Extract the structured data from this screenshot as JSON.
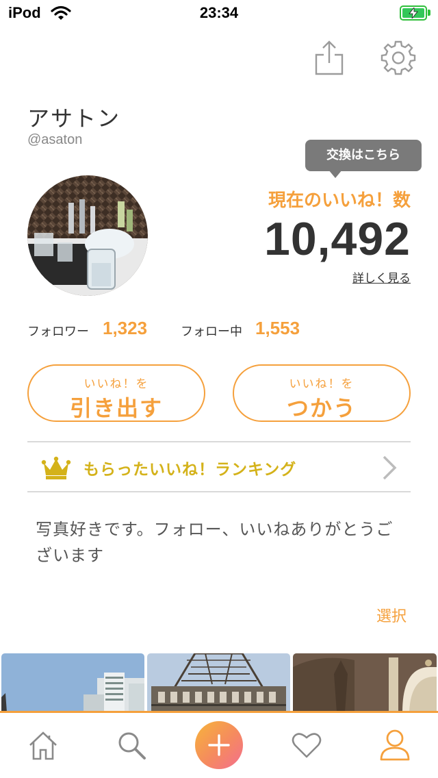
{
  "status_bar": {
    "device": "iPod",
    "time": "23:34"
  },
  "profile": {
    "display_name": "アサトン",
    "handle": "@asaton",
    "bio": "写真好きです。フォロー、いいねありがとうございます"
  },
  "exchange_tooltip": "交換はこちら",
  "likes": {
    "label": "現在のいいね！数",
    "count": "10,492",
    "details_link": "詳しく見る"
  },
  "stats": {
    "followers_label": "フォロワー",
    "followers_value": "1,323",
    "following_label": "フォロー中",
    "following_value": "1,553"
  },
  "actions": {
    "withdraw": {
      "small": "いいね！を",
      "big": "引き出す"
    },
    "use": {
      "small": "いいね！を",
      "big": "つかう"
    }
  },
  "ranking": {
    "label": "もらったいいね！ランキング"
  },
  "gallery": {
    "select_label": "選択"
  },
  "colors": {
    "accent": "#f5a03c",
    "crown": "#d4b21a",
    "tooltip": "#7a7a7a",
    "text": "#333333"
  },
  "icons": {
    "header": [
      "share-icon",
      "gear-icon"
    ],
    "tabbar": [
      "home-icon",
      "search-icon",
      "plus-icon",
      "heart-icon",
      "user-icon"
    ]
  }
}
